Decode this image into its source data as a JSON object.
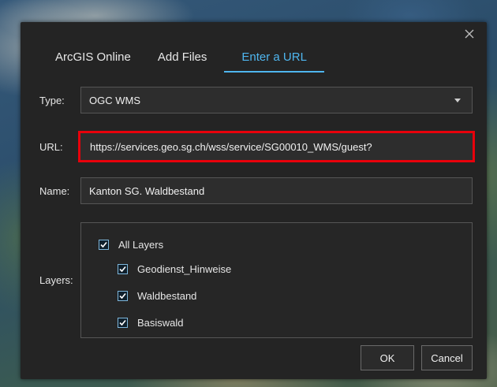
{
  "dialog": {
    "tabs": [
      {
        "label": "ArcGIS Online"
      },
      {
        "label": "Add Files"
      },
      {
        "label": "Enter a URL"
      }
    ],
    "type": {
      "label": "Type:",
      "value": "OGC WMS"
    },
    "url": {
      "label": "URL:",
      "value": "https://services.geo.sg.ch/wss/service/SG00010_WMS/guest?"
    },
    "name": {
      "label": "Name:",
      "value": "Kanton SG. Waldbestand"
    },
    "layers": {
      "label": "Layers:",
      "all": "All Layers",
      "items": [
        "Geodienst_Hinweise",
        "Waldbestand",
        "Basiswald"
      ]
    },
    "buttons": {
      "ok": "OK",
      "cancel": "Cancel"
    }
  },
  "colors": {
    "accent": "#4fb6ef",
    "highlight": "#e8000b",
    "dialog_bg": "#242424"
  }
}
